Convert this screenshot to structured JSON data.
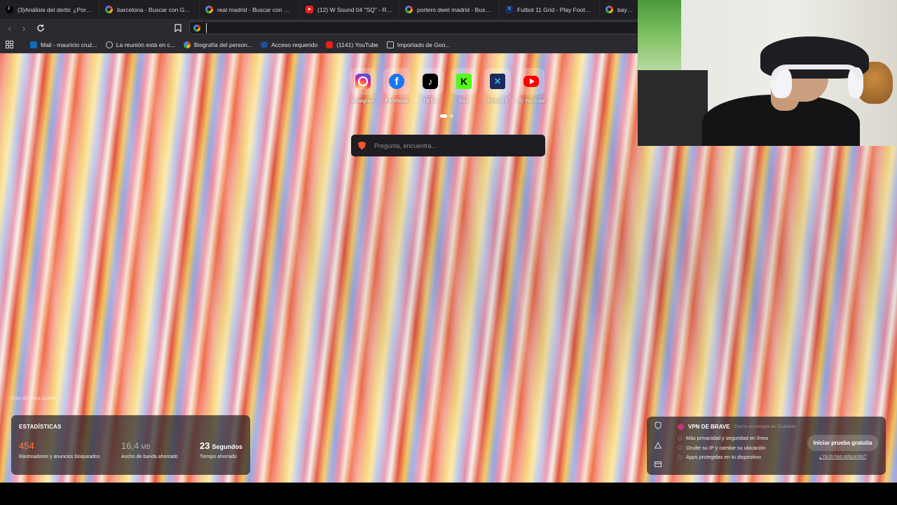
{
  "tabs": [
    {
      "icon": "tiktok-icon",
      "label": "(3)Análisis del derbi: ¿Por qué ..."
    },
    {
      "icon": "google-icon",
      "label": "barcelona - Buscar con Google"
    },
    {
      "icon": "google-icon",
      "label": "real madrid - Buscar con Goog"
    },
    {
      "icon": "youtube-icon",
      "label": "(12) W Sound 04 \"SQ\" - Ryan C"
    },
    {
      "icon": "google-icon",
      "label": "portero dwel madrid - Buscar c"
    },
    {
      "icon": "futbol11-icon",
      "label": "Futbol 11 Grid - Play Football T"
    },
    {
      "icon": "google-icon",
      "label": "bayern v"
    }
  ],
  "toolbar": {
    "address_value": ""
  },
  "bookmarks": [
    {
      "icon": "outlook-icon",
      "label": "Mail - mauricio cruz..."
    },
    {
      "icon": "globe-icon",
      "label": "La reunión está en c..."
    },
    {
      "icon": "google-icon",
      "label": "Biografía del person..."
    },
    {
      "icon": "access-icon",
      "label": "Acceso requerido"
    },
    {
      "icon": "youtube-icon",
      "label": "(1141) YouTube"
    },
    {
      "icon": "folder-icon",
      "label": "Importado de Goo..."
    }
  ],
  "shortcuts": [
    {
      "icon": "instagram-icon",
      "label": "Instagram",
      "glyph": ""
    },
    {
      "icon": "facebook-icon",
      "label": "Facebook",
      "glyph": "f"
    },
    {
      "icon": "tiktok-icon",
      "label": "TikTok",
      "glyph": "♪"
    },
    {
      "icon": "kick-icon",
      "label": "Kick",
      "glyph": "K"
    },
    {
      "icon": "futbol11-icon",
      "label": "Futbol11",
      "glyph": "✕"
    },
    {
      "icon": "youtube-icon",
      "label": "(6) YouTube",
      "glyph": ""
    }
  ],
  "search": {
    "placeholder": "Pregunta, encuentra..."
  },
  "photo_credit": "Foto de Zoha Gohar",
  "stats": {
    "heading": "ESTADÍSTICAS",
    "blocked": {
      "value": "454",
      "label": "Rastreadores y anuncios bloqueados"
    },
    "bandwidth": {
      "value": "16,4",
      "unit": "MB",
      "label": "Ancho de banda ahorrado"
    },
    "time": {
      "value": "23",
      "unit": "Segundos",
      "label": "Tiempo ahorrado"
    }
  },
  "vpn": {
    "title": "VPN DE BRAVE",
    "powered": "Con la tecnología de Guardian",
    "features": [
      "Más privacidad y seguridad en línea",
      "Oculte su IP y cambie su ubicación",
      "Apps protegidas en tu dispositivo"
    ],
    "cta": "Iniciar prueba gratuita",
    "link": "¿Ya lo has adquirido?"
  },
  "colors": {
    "accent_orange": "#ff7a4a",
    "brave_orange": "#fb542b",
    "panel_dark": "#1e1d22"
  }
}
